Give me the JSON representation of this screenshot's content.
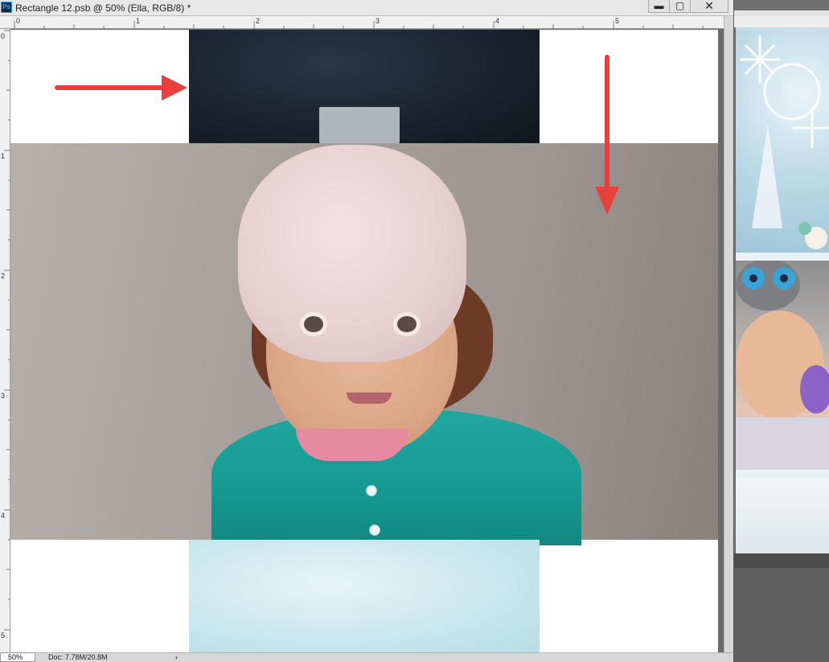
{
  "window": {
    "title": "Rectangle 12.psb @ 50% (Ella, RGB/8) *",
    "app_icon": "Ps",
    "minimize_glyph": "▬",
    "maximize_glyph": "▢",
    "close_glyph": "✕"
  },
  "rulers": {
    "horizontal_labels": [
      "0",
      "1",
      "2",
      "3",
      "4",
      "5"
    ],
    "vertical_labels": [
      "0",
      "1",
      "2",
      "3",
      "4",
      "5"
    ]
  },
  "canvas": {
    "layer": "Ella",
    "arrows_color": "#e8403c"
  },
  "statusbar": {
    "zoom": "50%",
    "doc_info": "Doc: 7.78M/20.8M",
    "menu_arrow": "›"
  },
  "icons": {
    "app": "photoshop-icon",
    "annotation_arrows": [
      "arrow-right-icon",
      "arrow-down-icon"
    ]
  }
}
